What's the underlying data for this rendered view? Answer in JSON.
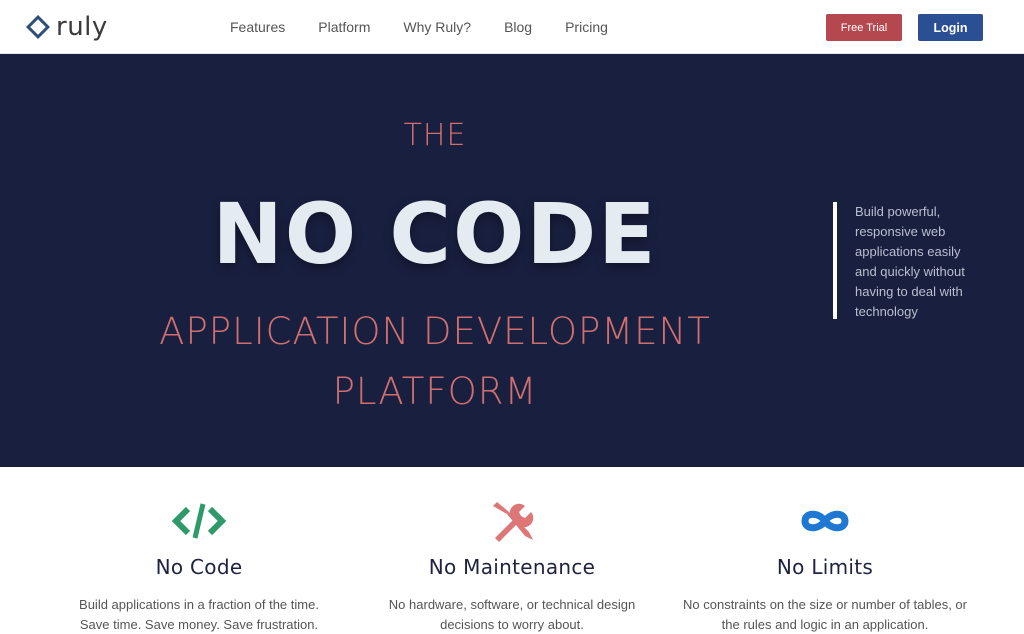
{
  "brand": {
    "name": "ruly",
    "logo_color": "#2f4f7a"
  },
  "nav": {
    "links": [
      "Features",
      "Platform",
      "Why Ruly?",
      "Blog",
      "Pricing"
    ],
    "free_trial_label": "Free Trial",
    "login_label": "Login",
    "free_trial_color": "#b5484e",
    "login_color": "#2a4f93"
  },
  "hero": {
    "background": "#191f3f",
    "accent": "#cf6f70",
    "line1": "THE",
    "line2": "NO CODE",
    "line3": "APPLICATION DEVELOPMENT",
    "line4": "PLATFORM",
    "side_text": [
      "Build powerful,",
      "responsive web",
      "applications easily",
      "and quickly without",
      "having to deal with",
      "technology"
    ]
  },
  "features": [
    {
      "icon": "code-icon",
      "icon_color": "#2e9a6a",
      "title": "No Code",
      "desc": [
        "Build applications in a fraction of the time.",
        "Save time. Save money. Save frustration."
      ]
    },
    {
      "icon": "tools-icon",
      "icon_color": "#dd7676",
      "title": "No Maintenance",
      "desc": [
        "No hardware, software, or technical design",
        "decisions to worry about."
      ]
    },
    {
      "icon": "infinity-icon",
      "icon_color": "#1f78d1",
      "title": "No Limits",
      "desc": [
        "No constraints on the size or number of tables, or",
        "the rules and logic in an application."
      ]
    }
  ]
}
